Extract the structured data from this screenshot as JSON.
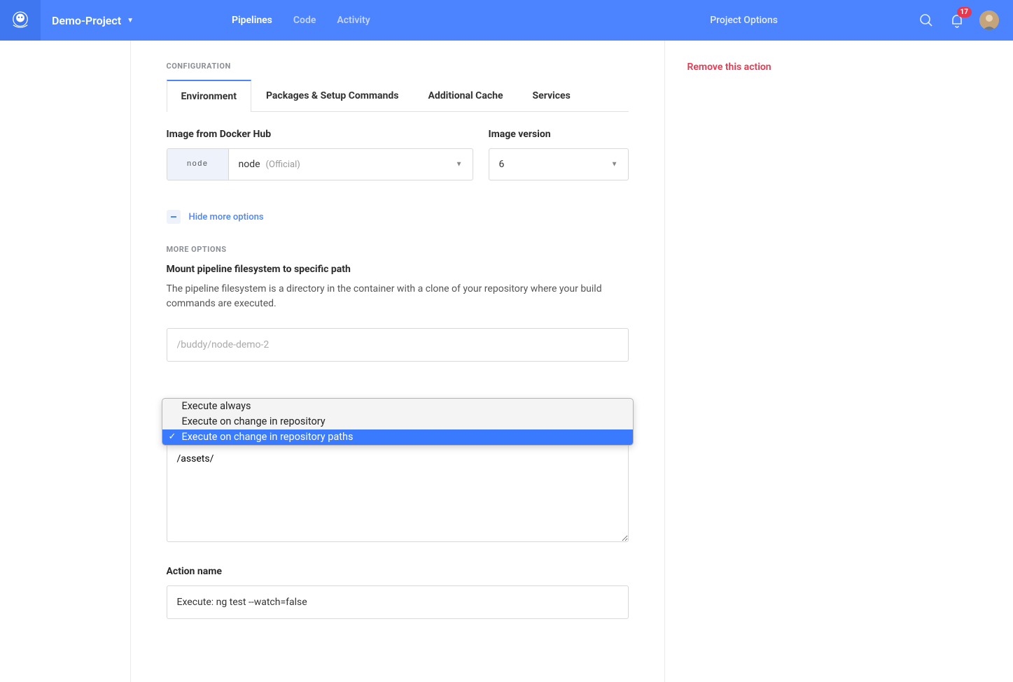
{
  "header": {
    "project_name": "Demo-Project",
    "nav": {
      "pipelines": "Pipelines",
      "code": "Code",
      "activity": "Activity"
    },
    "project_options": "Project Options",
    "notification_count": "17"
  },
  "sidebar": {
    "remove_action": "Remove this action"
  },
  "config": {
    "section_label": "CONFIGURATION",
    "tabs": {
      "environment": "Environment",
      "packages": "Packages & Setup Commands",
      "cache": "Additional Cache",
      "services": "Services"
    },
    "docker_image_label": "Image from Docker Hub",
    "docker_image_icon_text": "node",
    "docker_image_name": "node",
    "docker_image_official": "(Official)",
    "image_version_label": "Image version",
    "image_version_value": "6",
    "hide_more_options": "Hide more options",
    "more_options_label": "MORE OPTIONS",
    "mount_heading": "Mount pipeline filesystem to specific path",
    "mount_description": "The pipeline filesystem is a directory in the container with a clone of your repository where your build commands are executed.",
    "mount_placeholder": "/buddy/node-demo-2",
    "trigger_options": {
      "always": "Execute always",
      "on_change": "Execute on change in repository",
      "on_paths": "Execute on change in repository paths"
    },
    "paths_value": "/assets/",
    "action_name_label": "Action name",
    "action_name_value": "Execute: ng test --watch=false"
  }
}
